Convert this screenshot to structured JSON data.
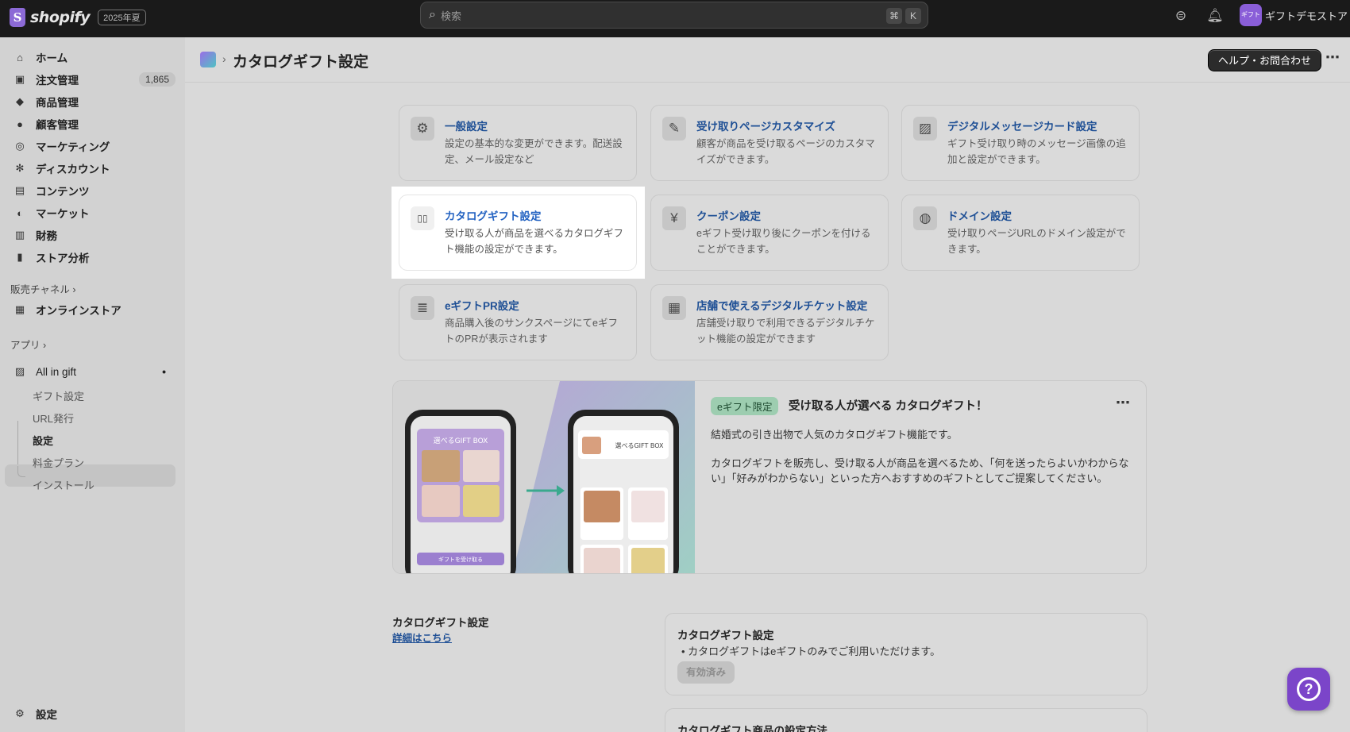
{
  "topbar": {
    "logo_word": "shopify",
    "logo_badge": "2025年夏",
    "search_placeholder": "検索",
    "shortcut_keys": [
      "⌘",
      "K"
    ],
    "store_avatar_text": "ギフトデモ",
    "store_name": "ギフトデモストア"
  },
  "sidebar": {
    "items": [
      {
        "label": "ホーム",
        "icon": "home-icon",
        "glyph": "⌂"
      },
      {
        "label": "注文管理",
        "icon": "orders-icon",
        "glyph": "▣",
        "count": "1,865"
      },
      {
        "label": "商品管理",
        "icon": "tag-icon",
        "glyph": "◆"
      },
      {
        "label": "顧客管理",
        "icon": "person-icon",
        "glyph": "●"
      },
      {
        "label": "マーケティング",
        "icon": "target-icon",
        "glyph": "◎"
      },
      {
        "label": "ディスカウント",
        "icon": "discount-icon",
        "glyph": "✻"
      },
      {
        "label": "コンテンツ",
        "icon": "content-icon",
        "glyph": "▤"
      },
      {
        "label": "マーケット",
        "icon": "globe-icon",
        "glyph": "◐"
      },
      {
        "label": "財務",
        "icon": "bank-icon",
        "glyph": "▥"
      },
      {
        "label": "ストア分析",
        "icon": "chart-icon",
        "glyph": "▮"
      }
    ],
    "sales_channel_label": "販売チャネル ›",
    "online_store": {
      "label": "オンラインストア",
      "glyph": "▦"
    },
    "apps_label": "アプリ ›",
    "app": {
      "label": "All in gift",
      "glyph": "▨",
      "dot": "•"
    },
    "app_sub_items": [
      "ギフト設定",
      "URL発行",
      "設定",
      "料金プラン",
      "インストール"
    ],
    "settings": {
      "label": "設定",
      "glyph": "⚙"
    }
  },
  "header": {
    "breadcrumb_sep": "›",
    "title": "カタログギフト設定",
    "help_button": "ヘルプ・お問合わせ",
    "more": "⋯"
  },
  "cards": [
    {
      "title": "一般設定",
      "desc": "設定の基本的な変更ができます。配送設定、メール設定など",
      "icon": "gear-icon",
      "glyph": "⚙"
    },
    {
      "title": "受け取りページカスタマイズ",
      "desc": "顧客が商品を受け取るページのカスタマイズができます。",
      "icon": "paint-brush-icon",
      "glyph": "✎"
    },
    {
      "title": "デジタルメッセージカード設定",
      "desc": "ギフト受け取り時のメッセージ画像の追加と設定ができます。",
      "icon": "image-icon",
      "glyph": "▨"
    },
    {
      "title": "カタログギフト設定",
      "desc": "受け取る人が商品を選べるカタログギフト機能の設定ができます。",
      "icon": "book-icon",
      "glyph": "▯▯"
    },
    {
      "title": "クーポン設定",
      "desc": "eギフト受け取り後にクーポンを付けることができます。",
      "icon": "coupon-icon",
      "glyph": "¥"
    },
    {
      "title": "ドメイン設定",
      "desc": "受け取りページURLのドメイン設定ができます。",
      "icon": "globe-icon",
      "glyph": "◍"
    },
    {
      "title": "eギフトPR設定",
      "desc": "商品購入後のサンクスページにてeギフトのPRが表示されます",
      "icon": "document-icon",
      "glyph": "≣"
    },
    {
      "title": "店舗で使えるデジタルチケット設定",
      "desc": "店舗受け取りで利用できるデジタルチケット機能の設定ができます",
      "icon": "qr-code-icon",
      "glyph": "▦"
    }
  ],
  "promo": {
    "tag": "eギフト限定",
    "title": "受け取る人が選べる カタログギフト！",
    "more": "⋯",
    "line1": "結婚式の引き出物で人気のカタログギフト機能です。",
    "line2": "カタログギフトを販売し、受け取る人が商品を選べるため、「何を送ったらよいかわからない」「好みがわからない」といった方へおすすめのギフトとしてご提案してください。",
    "phone1_header": "選べるGIFT BOX",
    "phone1_button": "ギフトを受け取る",
    "phone2_header": "選べるGIFT BOX"
  },
  "bottom": {
    "section_title": "カタログギフト設定",
    "section_link": "詳細はこちら",
    "box1_title": "カタログギフト設定",
    "box1_bullet": "カタログギフトはeギフトのみでご利用いただけます。",
    "box1_button": "有効済み",
    "box2_title": "カタログギフト商品の設定方法"
  },
  "chat": {
    "glyph": "?"
  }
}
